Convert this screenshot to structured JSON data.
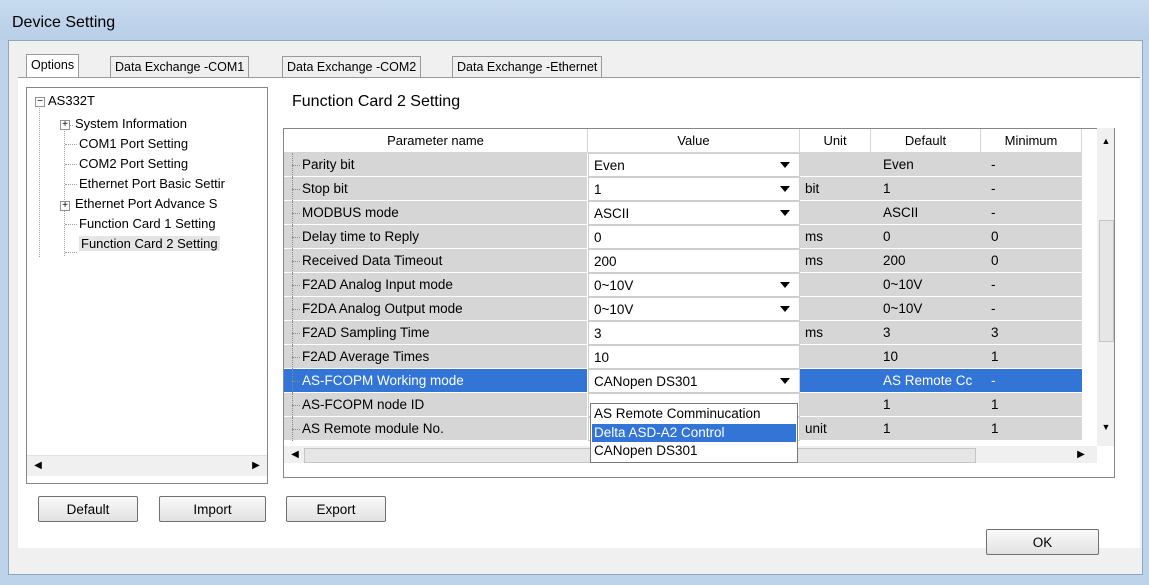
{
  "window": {
    "title": "Device Setting"
  },
  "tabs": [
    {
      "label": "Options",
      "active": true
    },
    {
      "label": "Data Exchange -COM1",
      "active": false
    },
    {
      "label": "Data Exchange -COM2",
      "active": false
    },
    {
      "label": "Data Exchange -Ethernet",
      "active": false
    }
  ],
  "tree": {
    "root": "AS332T",
    "items": [
      {
        "label": "System Information",
        "expandable": true
      },
      {
        "label": "COM1 Port Setting",
        "expandable": false
      },
      {
        "label": "COM2 Port Setting",
        "expandable": false
      },
      {
        "label": "Ethernet Port Basic Settir",
        "expandable": false
      },
      {
        "label": "Ethernet Port Advance S",
        "expandable": true
      },
      {
        "label": "Function Card 1 Setting",
        "expandable": false
      },
      {
        "label": "Function Card 2 Setting",
        "expandable": false,
        "selected": true
      }
    ]
  },
  "section_title": "Function Card 2 Setting",
  "grid": {
    "headers": [
      "Parameter name",
      "Value",
      "Unit",
      "Default",
      "Minimum"
    ],
    "rows": [
      {
        "name": "Parity bit",
        "value": "Even",
        "dropdown": true,
        "unit": "",
        "default": "Even",
        "minimum": "-"
      },
      {
        "name": "Stop bit",
        "value": "1",
        "dropdown": true,
        "unit": "bit",
        "default": "1",
        "minimum": "-"
      },
      {
        "name": "MODBUS mode",
        "value": "ASCII",
        "dropdown": true,
        "unit": "",
        "default": "ASCII",
        "minimum": "-"
      },
      {
        "name": "Delay time to Reply",
        "value": "0",
        "dropdown": false,
        "unit": "ms",
        "default": "0",
        "minimum": "0"
      },
      {
        "name": "Received Data Timeout",
        "value": "200",
        "dropdown": false,
        "unit": "ms",
        "default": "200",
        "minimum": "0"
      },
      {
        "name": "F2AD Analog Input mode",
        "value": "0~10V",
        "dropdown": true,
        "unit": "",
        "default": "0~10V",
        "minimum": "-"
      },
      {
        "name": "F2DA Analog Output mode",
        "value": "0~10V",
        "dropdown": true,
        "unit": "",
        "default": "0~10V",
        "minimum": "-"
      },
      {
        "name": "F2AD Sampling Time",
        "value": "3",
        "dropdown": false,
        "unit": "ms",
        "default": "3",
        "minimum": "3"
      },
      {
        "name": "F2AD Average Times",
        "value": "10",
        "dropdown": false,
        "unit": "",
        "default": "10",
        "minimum": "1"
      },
      {
        "name": "AS-FCOPM Working mode",
        "value": "CANopen DS301",
        "dropdown": true,
        "unit": "",
        "default": "AS Remote Cc",
        "minimum": "-",
        "selected": true
      },
      {
        "name": "AS-FCOPM node ID",
        "value": "",
        "dropdown": false,
        "unit": "",
        "default": "1",
        "minimum": "1"
      },
      {
        "name": "AS Remote module No.",
        "value": "",
        "dropdown": false,
        "unit": "unit",
        "default": "1",
        "minimum": "1"
      }
    ]
  },
  "dropdown_options": [
    {
      "label": "AS Remote Comminucation",
      "highlighted": false
    },
    {
      "label": "Delta ASD-A2 Control",
      "highlighted": true
    },
    {
      "label": "CANopen DS301",
      "highlighted": false
    }
  ],
  "buttons": {
    "default": "Default",
    "import": "Import",
    "export": "Export",
    "ok": "OK"
  },
  "colors": {
    "selection": "#3375d6",
    "readonly_cell": "#d6d6d6"
  }
}
